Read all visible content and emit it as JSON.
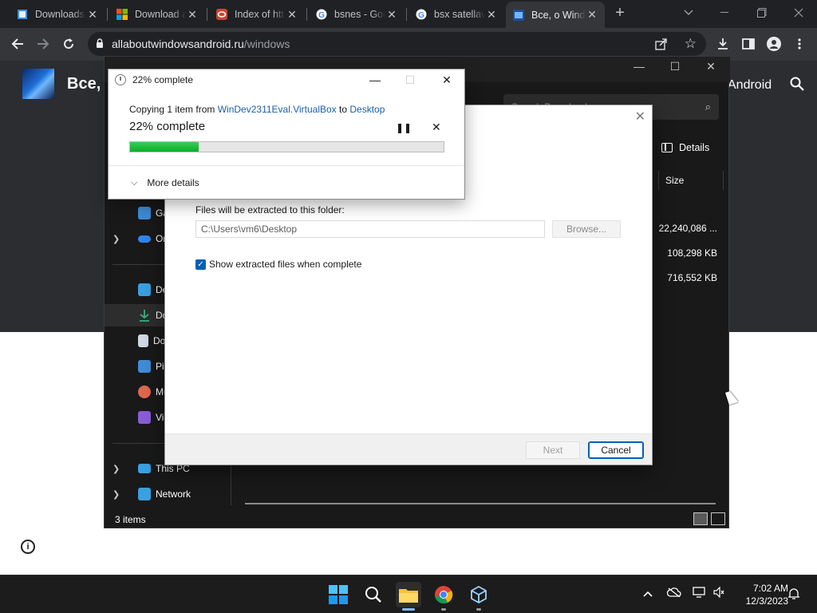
{
  "browser": {
    "tabs": [
      {
        "title": "Downloads",
        "favicon": "downloads-page-icon",
        "active": false
      },
      {
        "title": "Download a",
        "favicon": "windows-logo-icon",
        "active": false
      },
      {
        "title": "Index of htt",
        "favicon": "oracle-icon",
        "active": false
      },
      {
        "title": "bsnes - Goo",
        "favicon": "google-icon",
        "active": false
      },
      {
        "title": "bsx satellav",
        "favicon": "google-icon",
        "active": false
      },
      {
        "title": "Все, о Wind",
        "favicon": "site-icon",
        "active": true
      }
    ],
    "url_host": "allaboutwindowsandroid.ru",
    "url_path": "/windows"
  },
  "page": {
    "site_title": "Все, о",
    "site_tag": "Android"
  },
  "explorer": {
    "search_placeholder": "Search Downloads",
    "details_label": "Details",
    "nav": [
      {
        "label": "Gallery",
        "icon": "gallery-icon",
        "color": "#3f8cd8",
        "chevron": false
      },
      {
        "label": "OneDrive",
        "icon": "onedrive-icon",
        "color": "#2f86f0",
        "chevron": true
      },
      {
        "label": "Desktop",
        "icon": "desktop-icon",
        "color": "#3aa0e0",
        "chevron": false
      },
      {
        "label": "Downloads",
        "icon": "downloads-icon",
        "color": "#36b37e",
        "chevron": false,
        "selected": true
      },
      {
        "label": "Documents",
        "icon": "documents-icon",
        "color": "#cfd8e3",
        "chevron": false
      },
      {
        "label": "Pictures",
        "icon": "pictures-icon",
        "color": "#3f8cd8",
        "chevron": false
      },
      {
        "label": "Music",
        "icon": "music-icon",
        "color": "#e0674f",
        "chevron": false
      },
      {
        "label": "Videos",
        "icon": "videos-icon",
        "color": "#8a5cd8",
        "chevron": false
      },
      {
        "label": "This PC",
        "icon": "this-pc-icon",
        "color": "#3aa0e0",
        "chevron": true
      },
      {
        "label": "Network",
        "icon": "network-icon",
        "color": "#3aa0e0",
        "chevron": true
      }
    ],
    "size_header": "Size",
    "sizes": [
      "22,240,086 ...",
      "108,298 KB",
      "716,552 KB"
    ],
    "status": "3 items"
  },
  "extract": {
    "folder_label": "Files will be extracted to this folder:",
    "folder_path": "C:\\Users\\vm6\\Desktop",
    "browse_label": "Browse...",
    "checkbox_label": "Show extracted files when complete",
    "checkbox_checked": true,
    "next_label": "Next",
    "cancel_label": "Cancel"
  },
  "copy_dialog": {
    "title": "22% complete",
    "copying_prefix": "Copying 1 item from ",
    "source": "WinDev2311Eval.VirtualBox",
    "to_word": " to ",
    "destination": "Desktop",
    "percent_text": "22% complete",
    "progress": 0.22,
    "more_details": "More details"
  },
  "taskbar": {
    "apps": [
      {
        "name": "start-icon",
        "active": false
      },
      {
        "name": "search-icon",
        "active": false
      },
      {
        "name": "file-explorer-icon",
        "active": true
      },
      {
        "name": "chrome-icon",
        "active": false
      },
      {
        "name": "virtualbox-icon",
        "active": false
      }
    ],
    "time": "7:02 AM",
    "date": "12/3/2023"
  },
  "colors": {
    "accent": "#005fb8",
    "progress_green": "#06b025"
  }
}
